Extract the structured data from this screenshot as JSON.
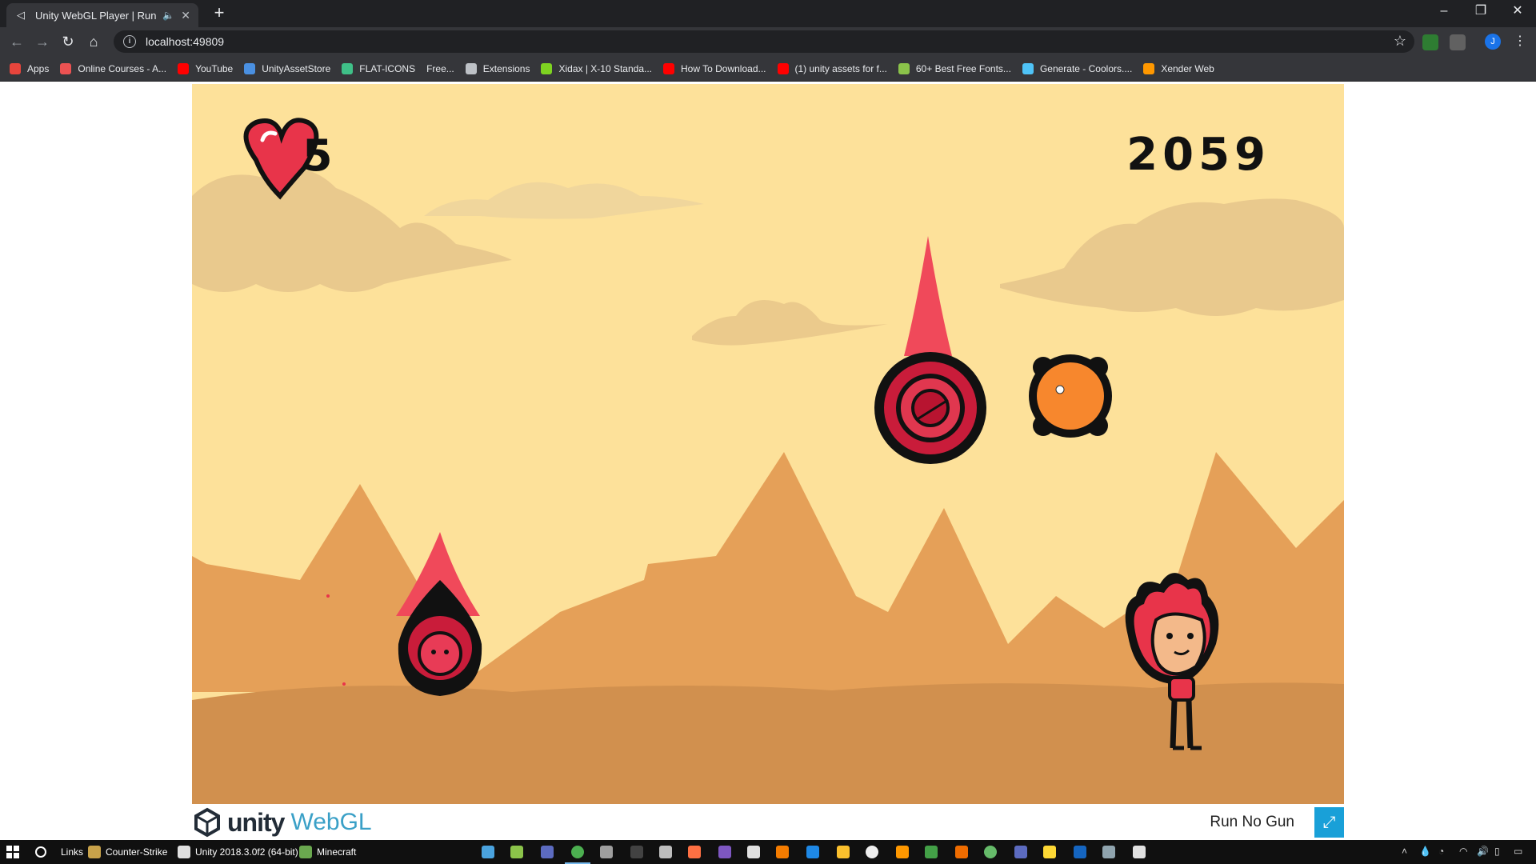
{
  "browser": {
    "tab_title": "Unity WebGL Player | Run No Gun",
    "new_tab": "+",
    "url": "localhost:49809",
    "profile_initial": "J"
  },
  "bookmarks": [
    {
      "label": "Apps",
      "icon": "apps-grid-icon",
      "color": "#e8453c"
    },
    {
      "label": "Online Courses - A...",
      "icon": "udemy-icon",
      "color": "#ec5252"
    },
    {
      "label": "YouTube",
      "icon": "youtube-icon",
      "color": "#ff0000"
    },
    {
      "label": "UnityAssetStore",
      "icon": "unity-asset-store-icon",
      "color": "#4a90e2"
    },
    {
      "label": "FLAT-ICONS",
      "icon": "flaticon-icon",
      "color": "#3fc088"
    },
    {
      "label": "Free...",
      "icon": "",
      "color": ""
    },
    {
      "label": "Extensions",
      "icon": "puzzle-piece-icon",
      "color": "#bdc1c6"
    },
    {
      "label": "Xidax | X-10 Standa...",
      "icon": "xidax-icon",
      "color": "#7ed321"
    },
    {
      "label": "How To Download...",
      "icon": "youtube-icon",
      "color": "#ff0000"
    },
    {
      "label": "(1) unity assets for f...",
      "icon": "youtube-icon",
      "color": "#ff0000"
    },
    {
      "label": "60+ Best Free Fonts...",
      "icon": "dafont-icon",
      "color": "#8bc34a"
    },
    {
      "label": "Generate - Coolors....",
      "icon": "coolors-icon",
      "color": "#4fc3f7"
    },
    {
      "label": "Xender Web",
      "icon": "xender-icon",
      "color": "#ff9800"
    }
  ],
  "game": {
    "lives": "5",
    "score": "2059"
  },
  "footer": {
    "unity_text": "unity",
    "webgl_text": "WebGL",
    "game_name": "Run No Gun",
    "fullscreen_icon": "⤢"
  },
  "taskbar": {
    "links_label": "Links",
    "items": [
      {
        "label": "Counter-Strike",
        "color": "#c8a24a"
      },
      {
        "label": "Unity 2018.3.0f2 (64-bit)",
        "color": "#e0e0e0"
      },
      {
        "label": "Minecraft",
        "color": "#6aa84f"
      }
    ]
  }
}
